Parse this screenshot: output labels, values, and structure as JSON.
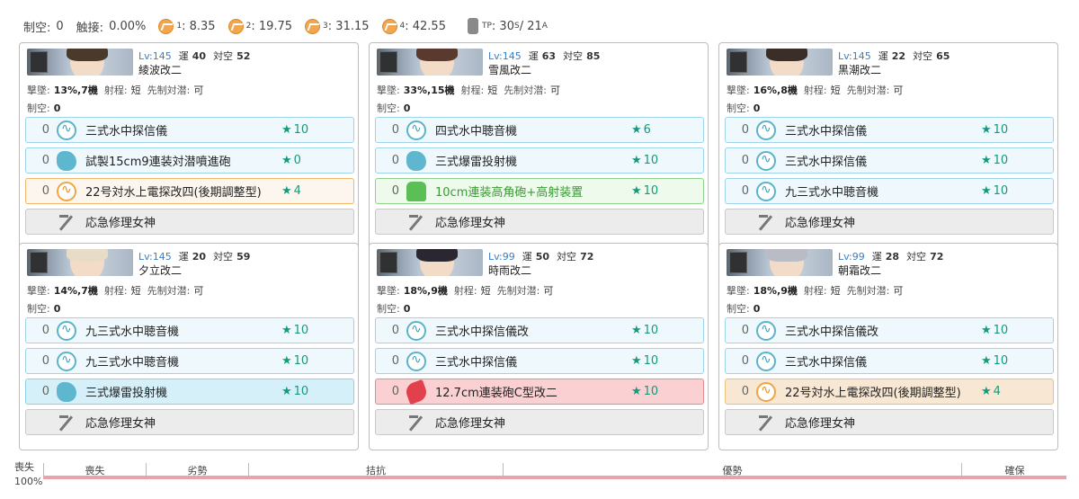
{
  "topbar": {
    "air_label": "制空:",
    "air_value": "0",
    "contact_label": "触接:",
    "contact_value": "0.00%",
    "los": [
      {
        "sub": "1",
        "value": ": 8.35"
      },
      {
        "sub": "2",
        "value": ": 19.75"
      },
      {
        "sub": "3",
        "value": ": 31.15"
      },
      {
        "sub": "4",
        "value": ": 42.55"
      }
    ],
    "tp_sub": "TP",
    "tp_value": ": 30",
    "tp_s_sub": "S",
    "tp_a_value": " / 21",
    "tp_a_sub": "A"
  },
  "labels": {
    "luck": "運",
    "aa": "対空",
    "shootdown": "撃墜:",
    "range": "射程:",
    "oasw": "先制対潜:",
    "air": "制空:"
  },
  "ships": [
    {
      "level": "Lv:145",
      "luck": "40",
      "aa": "52",
      "name": "綾波改二",
      "shootdown": "13%,7機",
      "range": "短",
      "oasw": "可",
      "air": "0",
      "hair": "#4a3a2c",
      "equips": [
        {
          "slot": "0",
          "icon": "sonar",
          "variant": "v-sonar",
          "name": "三式水中探信儀",
          "star": "★",
          "improve": "10"
        },
        {
          "slot": "0",
          "icon": "dc",
          "variant": "v-sonar",
          "name": "試製15cm9連装対潜噴進砲",
          "star": "★",
          "improve": "0"
        },
        {
          "slot": "0",
          "icon": "radar",
          "variant": "v-radar",
          "name": "22号対水上電探改四(後期調整型)",
          "star": "★",
          "improve": "4"
        },
        {
          "slot": "",
          "icon": "repair",
          "variant": "v-repair",
          "name": "応急修理女神",
          "star": "",
          "improve": ""
        }
      ]
    },
    {
      "level": "Lv:145",
      "luck": "63",
      "aa": "85",
      "name": "雪風改二",
      "shootdown": "33%,15機",
      "range": "短",
      "oasw": "可",
      "air": "0",
      "hair": "#5a3a2e",
      "equips": [
        {
          "slot": "0",
          "icon": "sonar",
          "variant": "v-sonar",
          "name": "四式水中聴音機",
          "star": "★",
          "improve": "6"
        },
        {
          "slot": "0",
          "icon": "dc",
          "variant": "v-sonar",
          "name": "三式爆雷投射機",
          "star": "★",
          "improve": "10"
        },
        {
          "slot": "0",
          "icon": "aa",
          "variant": "v-aa",
          "name": "10cm連装高角砲+高射装置",
          "star": "★",
          "improve": "10"
        },
        {
          "slot": "",
          "icon": "repair",
          "variant": "v-repair",
          "name": "応急修理女神",
          "star": "",
          "improve": ""
        }
      ]
    },
    {
      "level": "Lv:145",
      "luck": "22",
      "aa": "65",
      "name": "黒潮改二",
      "shootdown": "16%,8機",
      "range": "短",
      "oasw": "可",
      "air": "0",
      "hair": "#3b2e28",
      "equips": [
        {
          "slot": "0",
          "icon": "sonar",
          "variant": "v-sonar",
          "name": "三式水中探信儀",
          "star": "★",
          "improve": "10"
        },
        {
          "slot": "0",
          "icon": "sonar",
          "variant": "v-sonar",
          "name": "三式水中探信儀",
          "star": "★",
          "improve": "10"
        },
        {
          "slot": "0",
          "icon": "sonar",
          "variant": "v-sonar",
          "name": "九三式水中聴音機",
          "star": "★",
          "improve": "10"
        },
        {
          "slot": "",
          "icon": "repair",
          "variant": "v-repair",
          "name": "応急修理女神",
          "star": "",
          "improve": ""
        }
      ]
    },
    {
      "level": "Lv:145",
      "luck": "20",
      "aa": "59",
      "name": "夕立改二",
      "shootdown": "14%,7機",
      "range": "短",
      "oasw": "可",
      "air": "0",
      "hair": "#e9dcc7",
      "equips": [
        {
          "slot": "0",
          "icon": "sonar",
          "variant": "v-sonar",
          "name": "九三式水中聴音機",
          "star": "★",
          "improve": "10"
        },
        {
          "slot": "0",
          "icon": "sonar",
          "variant": "v-sonar",
          "name": "九三式水中聴音機",
          "star": "★",
          "improve": "10"
        },
        {
          "slot": "0",
          "icon": "dc",
          "variant": "v-dc-hl",
          "name": "三式爆雷投射機",
          "star": "★",
          "improve": "10"
        },
        {
          "slot": "",
          "icon": "repair",
          "variant": "v-repair",
          "name": "応急修理女神",
          "star": "",
          "improve": ""
        }
      ]
    },
    {
      "level": "Lv:99",
      "luck": "50",
      "aa": "72",
      "name": "時雨改二",
      "shootdown": "18%,9機",
      "range": "短",
      "oasw": "可",
      "air": "0",
      "hair": "#2b2730",
      "equips": [
        {
          "slot": "0",
          "icon": "sonar",
          "variant": "v-sonar",
          "name": "三式水中探信儀改",
          "star": "★",
          "improve": "10"
        },
        {
          "slot": "0",
          "icon": "sonar",
          "variant": "v-sonar",
          "name": "三式水中探信儀",
          "star": "★",
          "improve": "10"
        },
        {
          "slot": "0",
          "icon": "gun",
          "variant": "v-gun",
          "name": "12.7cm連装砲C型改二",
          "star": "★",
          "improve": "10"
        },
        {
          "slot": "",
          "icon": "repair",
          "variant": "v-repair",
          "name": "応急修理女神",
          "star": "",
          "improve": ""
        }
      ]
    },
    {
      "level": "Lv:99",
      "luck": "28",
      "aa": "72",
      "name": "朝霜改二",
      "shootdown": "18%,9機",
      "range": "短",
      "oasw": "可",
      "air": "0",
      "hair": "#b9bcc4",
      "equips": [
        {
          "slot": "0",
          "icon": "sonar",
          "variant": "v-sonar",
          "name": "三式水中探信儀改",
          "star": "★",
          "improve": "10"
        },
        {
          "slot": "0",
          "icon": "sonar",
          "variant": "v-sonar",
          "name": "三式水中探信儀",
          "star": "★",
          "improve": "10"
        },
        {
          "slot": "0",
          "icon": "radar",
          "variant": "v-radar-hl",
          "name": "22号対水上電探改四(後期調整型)",
          "star": "★",
          "improve": "4"
        },
        {
          "slot": "",
          "icon": "repair",
          "variant": "v-repair",
          "name": "応急修理女神",
          "star": "",
          "improve": ""
        }
      ]
    }
  ],
  "airbar": {
    "left_label": "喪失",
    "percent": "100%",
    "segments": [
      "喪失",
      "劣勢",
      "拮抗",
      "優勢",
      "確保"
    ]
  }
}
